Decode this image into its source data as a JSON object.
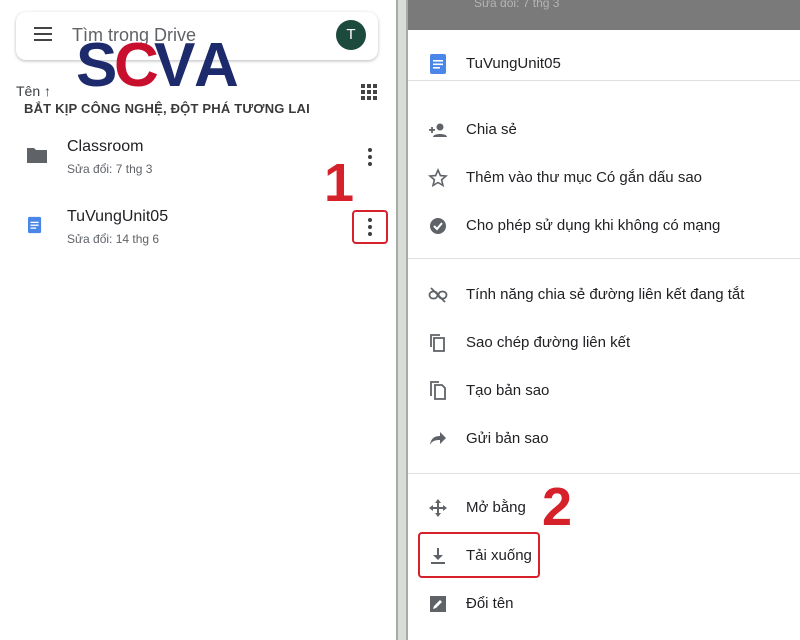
{
  "left_panel": {
    "search_placeholder": "Tìm trong Drive",
    "avatar_initial": "T",
    "logo_text": "SCVA",
    "slogan": "BẮT KỊP CÔNG NGHỆ, ĐỘT PHÁ TƯƠNG LAI",
    "sort_label": "Tên ↑",
    "files": [
      {
        "name": "Classroom",
        "meta": "Sửa đổi: 7 thg 3",
        "type": "folder"
      },
      {
        "name": "TuVungUnit05",
        "meta": "Sửa đổi: 14 thg 6",
        "type": "doc"
      }
    ],
    "step_label": "1"
  },
  "right_panel": {
    "top_peek_text": "Sửa đổi: 7 thg 3",
    "title": "TuVungUnit05",
    "items": [
      {
        "label": "Chia sẻ",
        "icon": "person-add-icon"
      },
      {
        "label": "Thêm vào thư mục Có gắn dấu sao",
        "icon": "star-icon"
      },
      {
        "label": "Cho phép sử dụng khi không có mạng",
        "icon": "offline-check-icon"
      },
      {
        "label": "Tính năng chia sẻ đường liên kết đang tắt",
        "icon": "link-off-icon"
      },
      {
        "label": "Sao chép đường liên kết",
        "icon": "copy-icon"
      },
      {
        "label": "Tạo bản sao",
        "icon": "file-copy-icon"
      },
      {
        "label": "Gửi bản sao",
        "icon": "send-icon"
      },
      {
        "label": "Mở bằng",
        "icon": "open-with-icon"
      },
      {
        "label": "Tải xuống",
        "icon": "download-icon"
      },
      {
        "label": "Đổi tên",
        "icon": "rename-icon"
      }
    ],
    "step_label": "2"
  },
  "colors": {
    "highlight": "#d6212b",
    "doc_blue": "#4a86e8",
    "logo_navy": "#1d2a6b",
    "logo_red": "#c8102e"
  }
}
